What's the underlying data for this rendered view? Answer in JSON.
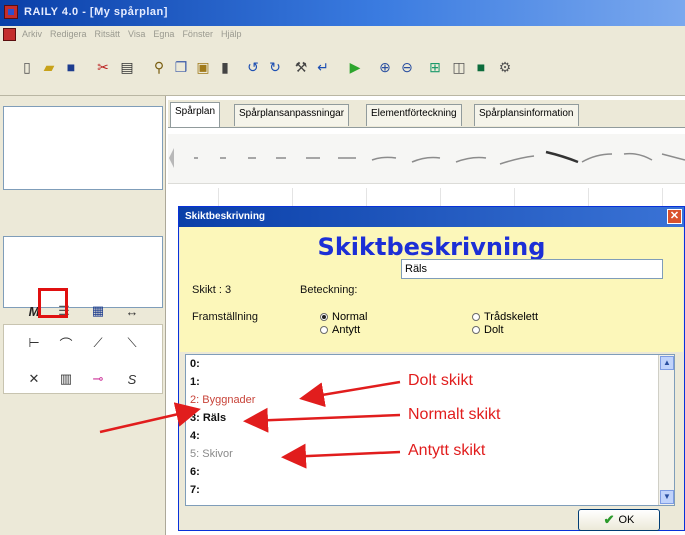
{
  "app": {
    "title": "RAILY 4.0 - [My spårplan]"
  },
  "menu": {
    "items": [
      "Arkiv",
      "Redigera",
      "Ritsätt",
      "Visa",
      "Egna",
      "Fönster",
      "Hjälp"
    ]
  },
  "toolbar": {
    "icons": [
      "new-file-icon",
      "open-folder-icon",
      "save-icon",
      "cut-icon",
      "print-icon",
      "find-icon",
      "copy-icon",
      "paste-icon",
      "delete-icon",
      "rotate-left-icon",
      "rotate-right-icon",
      "tool-icon",
      "enter-icon",
      "play-icon",
      "zoom-in-icon",
      "zoom-out-icon",
      "fit-icon",
      "layers-icon",
      "color-icon",
      "settings-icon"
    ]
  },
  "tabs": [
    "Spårplan",
    "Spårplansanpassningar",
    "Elementförteckning",
    "Spårplansinformation"
  ],
  "dialog": {
    "title": "Skiktbeskrivning",
    "heading": "Skiktbeskrivning",
    "layer_label": "Skikt : 3",
    "name_label": "Beteckning:",
    "name_value": "Räls",
    "presentation_label": "Framställning",
    "options": {
      "normal": "Normal",
      "hinted": "Antytt",
      "skeleton": "Trådskelett",
      "hidden": "Dolt"
    },
    "selected_option": "normal",
    "layers": [
      {
        "id": "0:",
        "name": ""
      },
      {
        "id": "1:",
        "name": ""
      },
      {
        "id": "2:",
        "name": "Byggnader"
      },
      {
        "id": "3:",
        "name": "Räls"
      },
      {
        "id": "4:",
        "name": ""
      },
      {
        "id": "5:",
        "name": "Skivor"
      },
      {
        "id": "6:",
        "name": ""
      },
      {
        "id": "7:",
        "name": ""
      }
    ],
    "ok_label": "OK",
    "close_glyph": "✕"
  },
  "annotations": {
    "hidden": "Dolt skikt",
    "normal": "Normalt skikt",
    "hinted": "Antytt skikt"
  },
  "colors": {
    "annotation": "#e11d1d",
    "heading": "#1c2fd6",
    "band": "#fcf7ba"
  }
}
